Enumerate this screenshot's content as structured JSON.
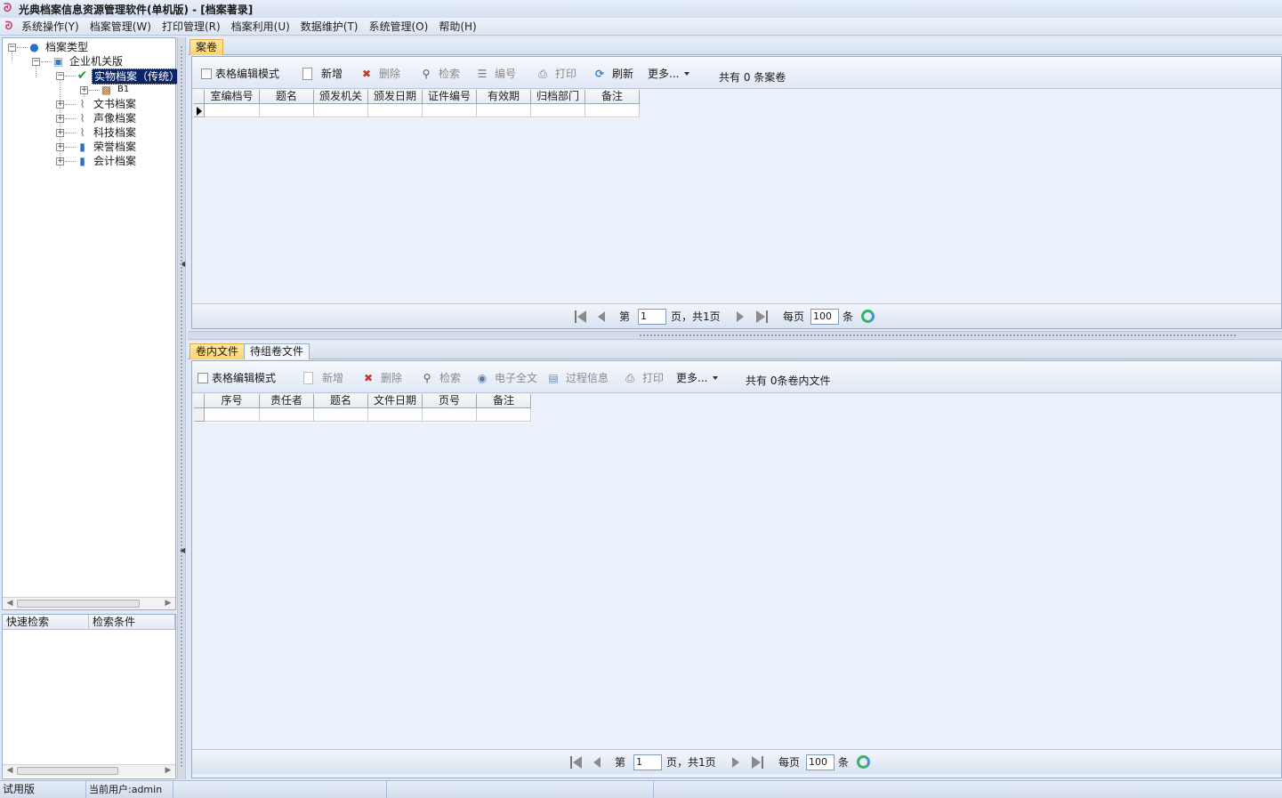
{
  "window": {
    "title": "光典档案信息资源管理软件(单机版) - [档案著录]"
  },
  "menu": [
    "系统操作(Y)",
    "档案管理(W)",
    "打印管理(R)",
    "档案利用(U)",
    "数据维护(T)",
    "系统管理(O)",
    "帮助(H)"
  ],
  "tree": {
    "root": "档案类型",
    "org": "企业机关版",
    "selected": "实物档案（传统）",
    "child_b1": "B1",
    "items": [
      "文书档案",
      "声像档案",
      "科技档案",
      "荣誉档案",
      "会计档案"
    ]
  },
  "search_panel": {
    "tab_quick": "快速检索",
    "tab_conditions": "检索条件"
  },
  "upper": {
    "tab": "案卷",
    "toolbar": {
      "grid_edit": "表格编辑模式",
      "add": "新增",
      "delete": "删除",
      "search": "检索",
      "number": "编号",
      "print": "打印",
      "refresh": "刷新",
      "more": "更多...",
      "count": "共有 0 条案卷"
    },
    "columns": [
      "室编档号",
      "题名",
      "颁发机关",
      "颁发日期",
      "证件编号",
      "有效期",
      "归档部门",
      "备注"
    ],
    "pager": {
      "page_prefix": "第",
      "page_value": "1",
      "page_suffix": "页，共1页",
      "per_page_label": "每页",
      "per_page_value": "100",
      "unit": "条"
    }
  },
  "lower": {
    "tabs": [
      "卷内文件",
      "待组卷文件"
    ],
    "toolbar": {
      "grid_edit": "表格编辑模式",
      "add": "新增",
      "delete": "删除",
      "search": "检索",
      "fulltext": "电子全文",
      "process": "过程信息",
      "print": "打印",
      "more": "更多...",
      "count": "共有 0条卷内文件"
    },
    "columns": [
      "序号",
      "责任者",
      "题名",
      "文件日期",
      "页号",
      "备注"
    ],
    "pager": {
      "page_prefix": "第",
      "page_value": "1",
      "page_suffix": "页，共1页",
      "per_page_label": "每页",
      "per_page_value": "100",
      "unit": "条"
    }
  },
  "status": {
    "edition": "试用版",
    "user": "当前用户:admin"
  }
}
